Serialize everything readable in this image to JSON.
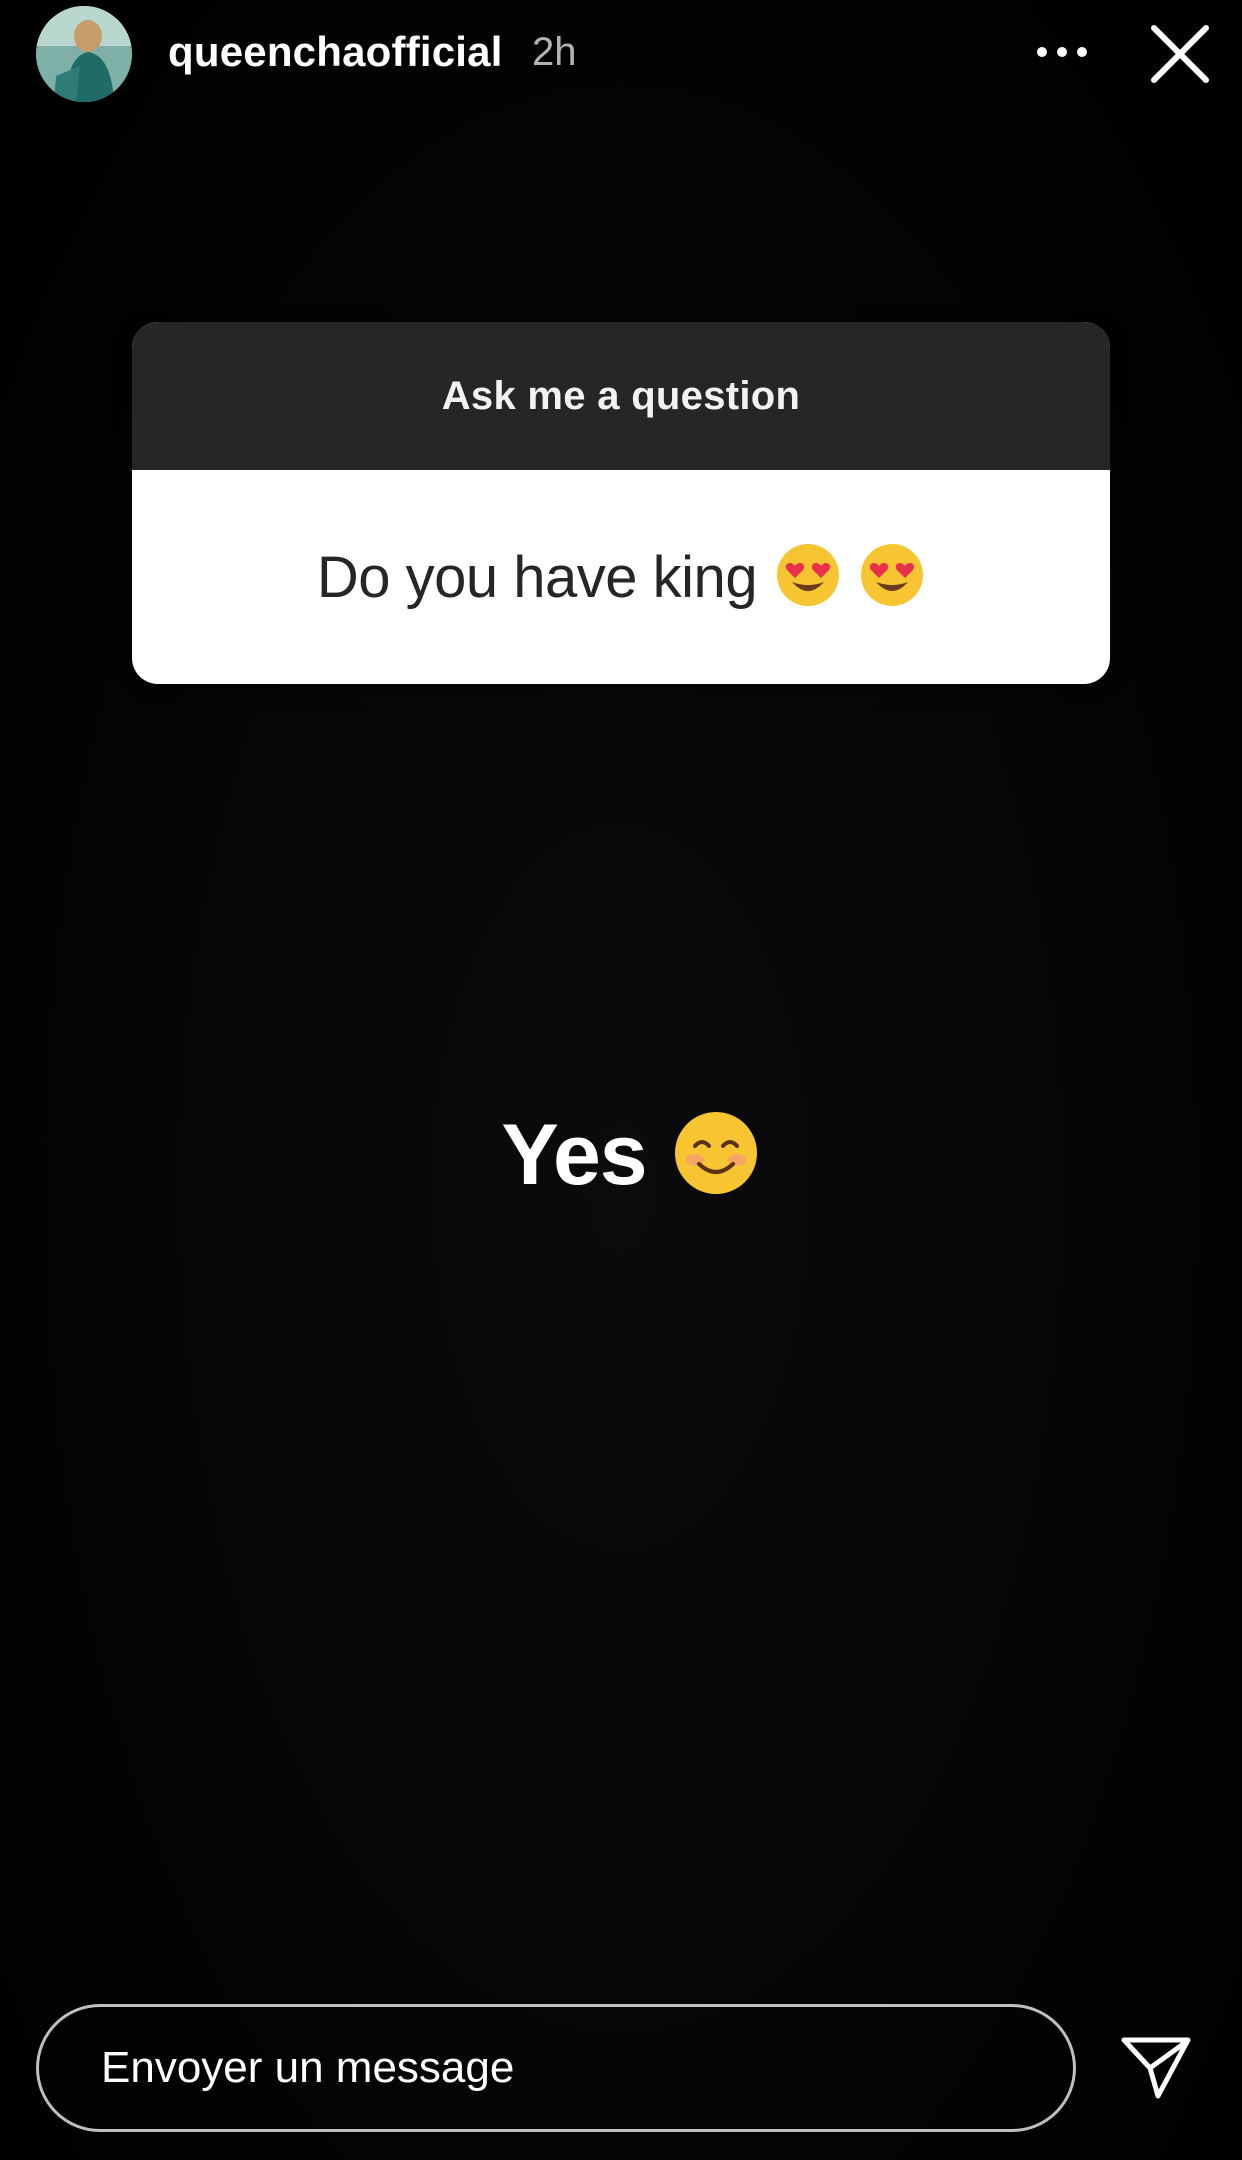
{
  "header": {
    "username": "queenchaofficial",
    "time": "2h",
    "more_icon": "more-horizontal-icon",
    "close_icon": "close-icon"
  },
  "question_sticker": {
    "label": "Ask me a question",
    "question": "Do you have king",
    "emojis": [
      "heart-eyes-emoji",
      "heart-eyes-emoji"
    ]
  },
  "answer": {
    "text": "Yes",
    "emoji": "smiling-face-emoji"
  },
  "footer": {
    "message_placeholder": "Envoyer un message",
    "send_icon": "send-icon"
  },
  "colors": {
    "background": "#000000",
    "sticker_header": "#262626",
    "sticker_body": "#ffffff",
    "text_primary": "#ffffff"
  }
}
